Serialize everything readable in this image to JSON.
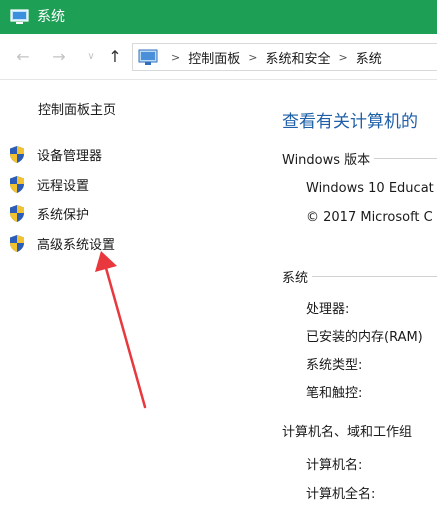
{
  "window": {
    "title": "系统"
  },
  "navigation": {
    "back_icon": "←",
    "forward_icon": "→",
    "dropdown_icon": "∨",
    "up_icon": "↑",
    "breadcrumbs": [
      "控制面板",
      "系统和安全",
      "系统"
    ],
    "separator": ">"
  },
  "sidebar": {
    "home": "控制面板主页",
    "items": [
      {
        "label": "设备管理器",
        "icon": "shield-icon"
      },
      {
        "label": "远程设置",
        "icon": "shield-icon"
      },
      {
        "label": "系统保护",
        "icon": "shield-icon"
      },
      {
        "label": "高级系统设置",
        "icon": "shield-icon"
      }
    ]
  },
  "main": {
    "heading": "查看有关计算机的",
    "windows_edition": {
      "header": "Windows 版本",
      "edition": "Windows 10 Educat",
      "copyright": "© 2017 Microsoft C"
    },
    "system": {
      "header": "系统",
      "rows": [
        "处理器:",
        "已安装的内存(RAM)",
        "系统类型:",
        "笔和触控:"
      ]
    },
    "computer_name": {
      "header": "计算机名、域和工作组",
      "rows": [
        "计算机名:",
        "计算机全名:"
      ]
    }
  },
  "annotation": {
    "arrow_color": "#e8383d"
  },
  "colors": {
    "titlebar": "#1e9f56",
    "heading": "#1e5fa8",
    "shield_blue": "#2a5cb8",
    "shield_yellow": "#f2c230"
  }
}
